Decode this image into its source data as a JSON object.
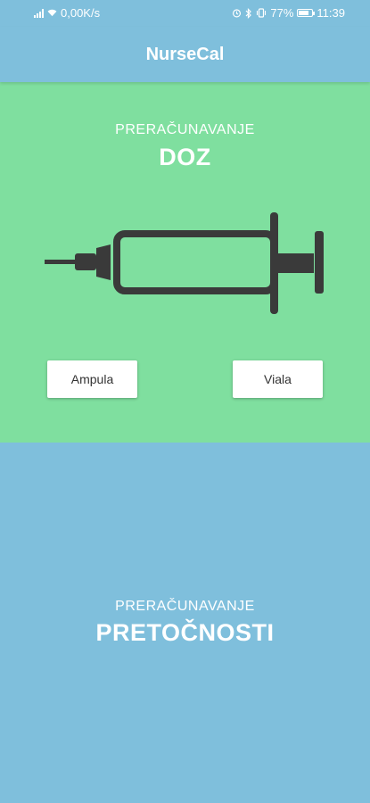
{
  "status_bar": {
    "net_speed": "0,00K/s",
    "battery": "77%",
    "time": "11:39",
    "icons": [
      "signal-icon",
      "wifi-icon",
      "alarm-icon",
      "bluetooth-icon",
      "vibrate-icon",
      "battery-icon"
    ]
  },
  "app_bar": {
    "title": "NurseCal"
  },
  "doz_section": {
    "subtitle": "PRERAČUNAVANJE",
    "title": "DOZ",
    "icon": "syringe-icon",
    "buttons": {
      "ampula": "Ampula",
      "viala": "Viala"
    }
  },
  "pretok_section": {
    "subtitle": "PRERAČUNAVANJE",
    "title": "PRETOČNOSTI"
  },
  "colors": {
    "primary": "#7fbfdc",
    "green": "#7fdf9f",
    "icon_dark": "#3a3a3a",
    "button_bg": "#ffffff"
  },
  "battery_level": 0.77
}
